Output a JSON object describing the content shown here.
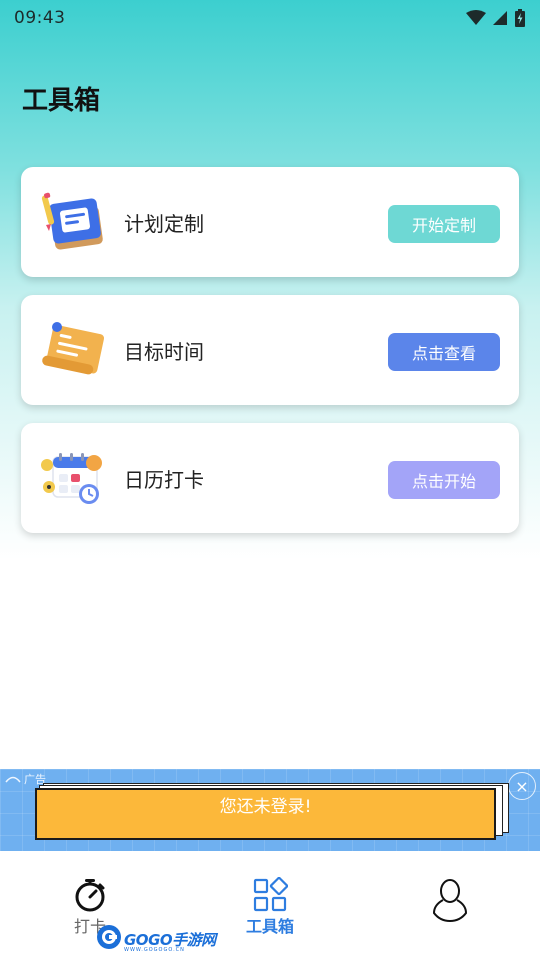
{
  "status_bar": {
    "time": "09:43",
    "icons": [
      "wifi-icon",
      "signal-icon",
      "battery-icon"
    ]
  },
  "page": {
    "title": "工具箱",
    "gradient_top": "#3ccfcf"
  },
  "cards": [
    {
      "title": "计划定制",
      "button": "开始定制",
      "button_color": "#6ed8d4",
      "icon": "notebook-pencil-icon"
    },
    {
      "title": "目标时间",
      "button": "点击查看",
      "button_color": "#5b85ea",
      "icon": "scroll-note-icon"
    },
    {
      "title": "日历打卡",
      "button": "点击开始",
      "button_color": "#a3a4f8",
      "icon": "calendar-clock-icon"
    }
  ],
  "ad": {
    "label": "广告",
    "text": "您还未登录!",
    "box_color": "#fcb83a",
    "background": "#6fb0f0"
  },
  "bottom_nav": {
    "items": [
      {
        "label": "打卡",
        "icon": "stopwatch-icon",
        "active": false
      },
      {
        "label": "工具箱",
        "icon": "grid-apps-icon",
        "active": true
      },
      {
        "label": "",
        "icon": "person-icon",
        "active": false
      }
    ],
    "active_color": "#2e7de0"
  },
  "watermark": {
    "text": "GOGO手游网",
    "sub": "WWW.GOGOGO.CN"
  }
}
